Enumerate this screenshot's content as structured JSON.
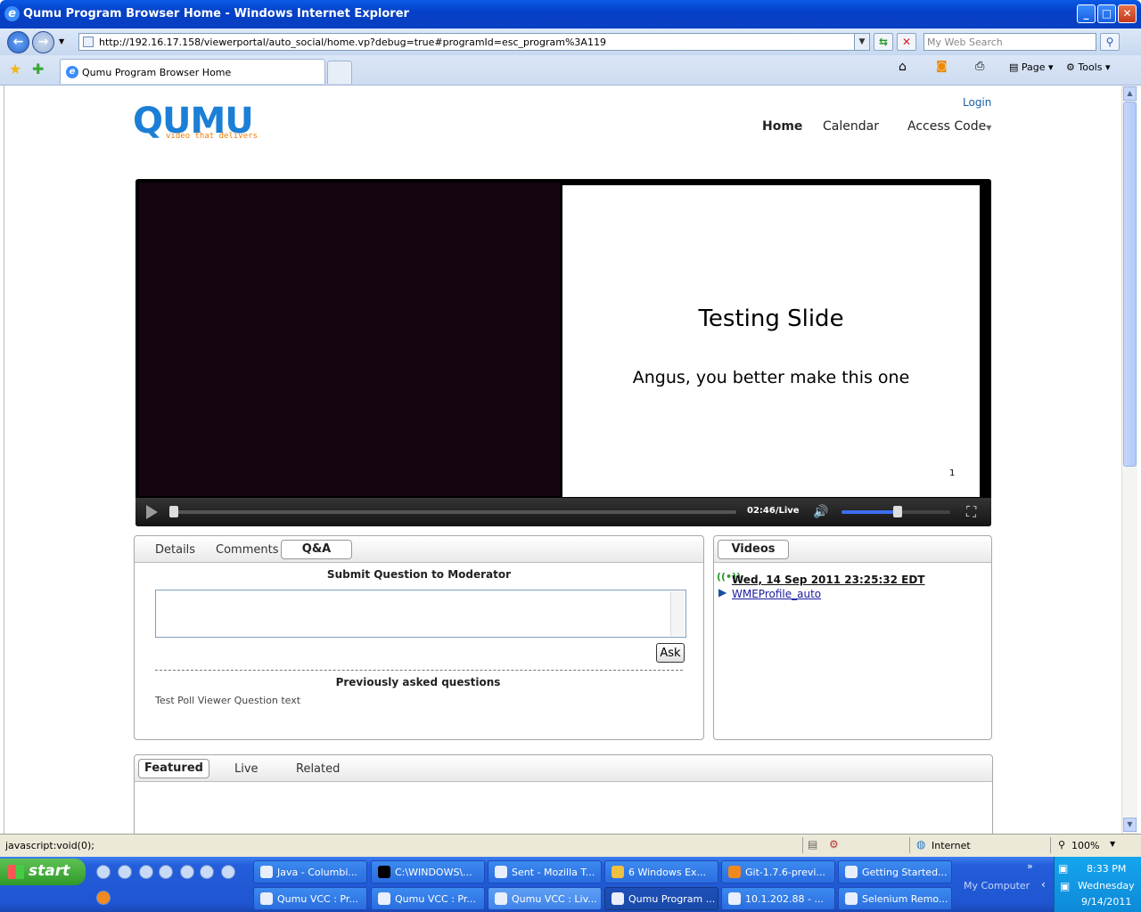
{
  "window": {
    "title": "Qumu Program Browser Home - Windows Internet Explorer"
  },
  "address": {
    "url": "http://192.16.17.158/viewerportal/auto_social/home.vp?debug=true#programId=esc_program%3A119",
    "search_placeholder": "My Web Search"
  },
  "tabs": [
    {
      "label": "Qumu Program Browser Home"
    }
  ],
  "commandbar": {
    "page": "Page",
    "tools": "Tools"
  },
  "site": {
    "logo": "QUMU",
    "tagline": "video that delivers",
    "login": "Login",
    "nav": [
      "Home",
      "Calendar",
      "Access Code"
    ]
  },
  "player": {
    "slide_title": "Testing Slide",
    "slide_body": "Angus, you better make this one",
    "slide_number": "1",
    "time": "02:46/Live",
    "volume": 0.5,
    "progress": 0.0
  },
  "qa_panel": {
    "tabs": [
      "Details",
      "Comments",
      "Q&A"
    ],
    "active_tab": "Q&A",
    "submit_title": "Submit Question to Moderator",
    "ask_label": "Ask",
    "previous_title": "Previously asked questions",
    "previous_questions": [
      "Test Poll Viewer Question text"
    ]
  },
  "videos_panel": {
    "tab": "Videos",
    "items": [
      {
        "label": "Wed, 14 Sep 2011 23:25:32 EDT",
        "icon": "live-icon"
      },
      {
        "label": "WMEProfile_auto",
        "icon": "play-icon"
      }
    ]
  },
  "featured_panel": {
    "tabs": [
      "Featured",
      "Live",
      "Related"
    ],
    "active_tab": "Featured"
  },
  "statusbar": {
    "left": "javascript:void(0);",
    "zone": "Internet",
    "zoom": "100%"
  },
  "taskbar": {
    "start": "start",
    "buttons_row1": [
      "Java - Columbi...",
      "C:\\WINDOWS\\...",
      "Sent - Mozilla T...",
      "6 Windows Ex...",
      "Git-1.7.6-previ...",
      "Getting Started..."
    ],
    "buttons_row2": [
      "Qumu VCC : Pr...",
      "Qumu VCC : Pr...",
      "Qumu VCC : Liv...",
      "Qumu Program ...",
      "10.1.202.88 - ...",
      "Selenium Remo..."
    ],
    "tray_label": "My Computer",
    "clock_time": "8:33 PM",
    "clock_day": "Wednesday",
    "clock_date": "9/14/2011"
  }
}
